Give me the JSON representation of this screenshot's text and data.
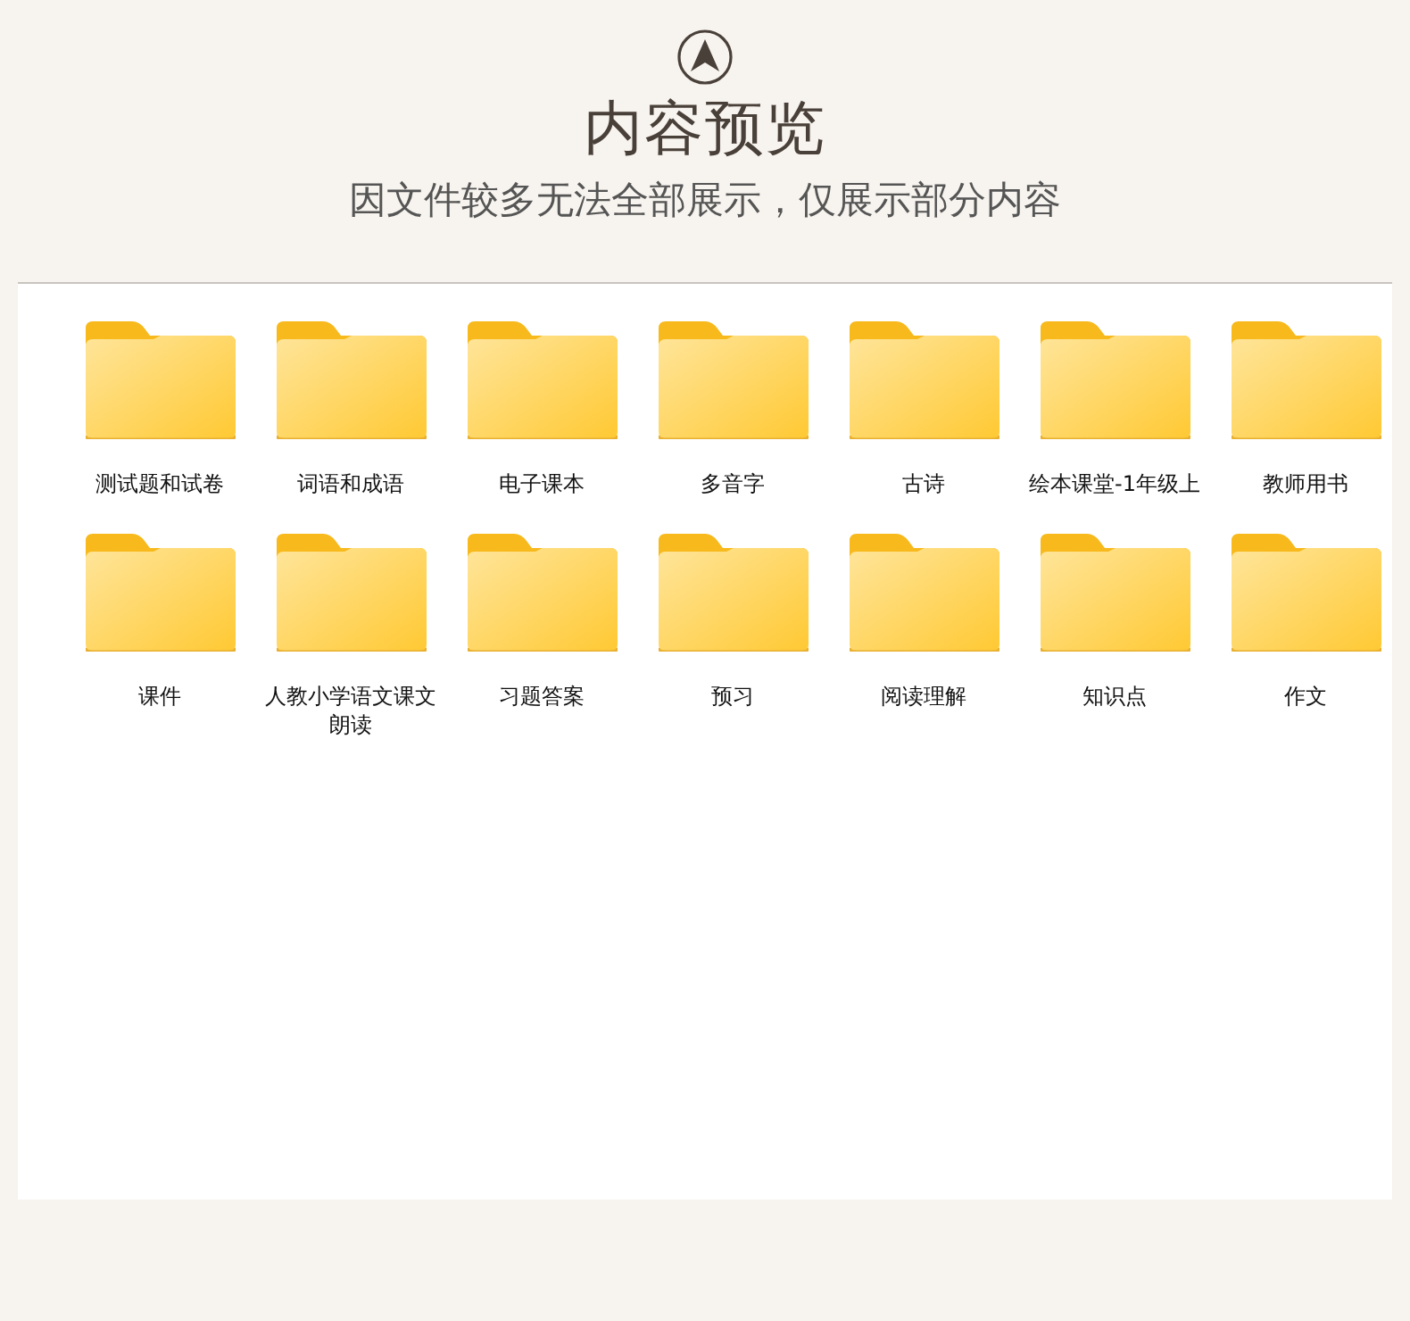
{
  "header": {
    "title": "内容预览",
    "subtitle": "因文件较多无法全部展示，仅展示部分内容"
  },
  "folders": [
    {
      "name": "测试题和试卷"
    },
    {
      "name": "词语和成语"
    },
    {
      "name": "电子课本"
    },
    {
      "name": "多音字"
    },
    {
      "name": "古诗"
    },
    {
      "name": "绘本课堂-1年级上"
    },
    {
      "name": "教师用书"
    },
    {
      "name": "课件"
    },
    {
      "name": "人教小学语文课文朗读"
    },
    {
      "name": "习题答案"
    },
    {
      "name": "预习"
    },
    {
      "name": "阅读理解"
    },
    {
      "name": "知识点"
    },
    {
      "name": "作文"
    }
  ]
}
